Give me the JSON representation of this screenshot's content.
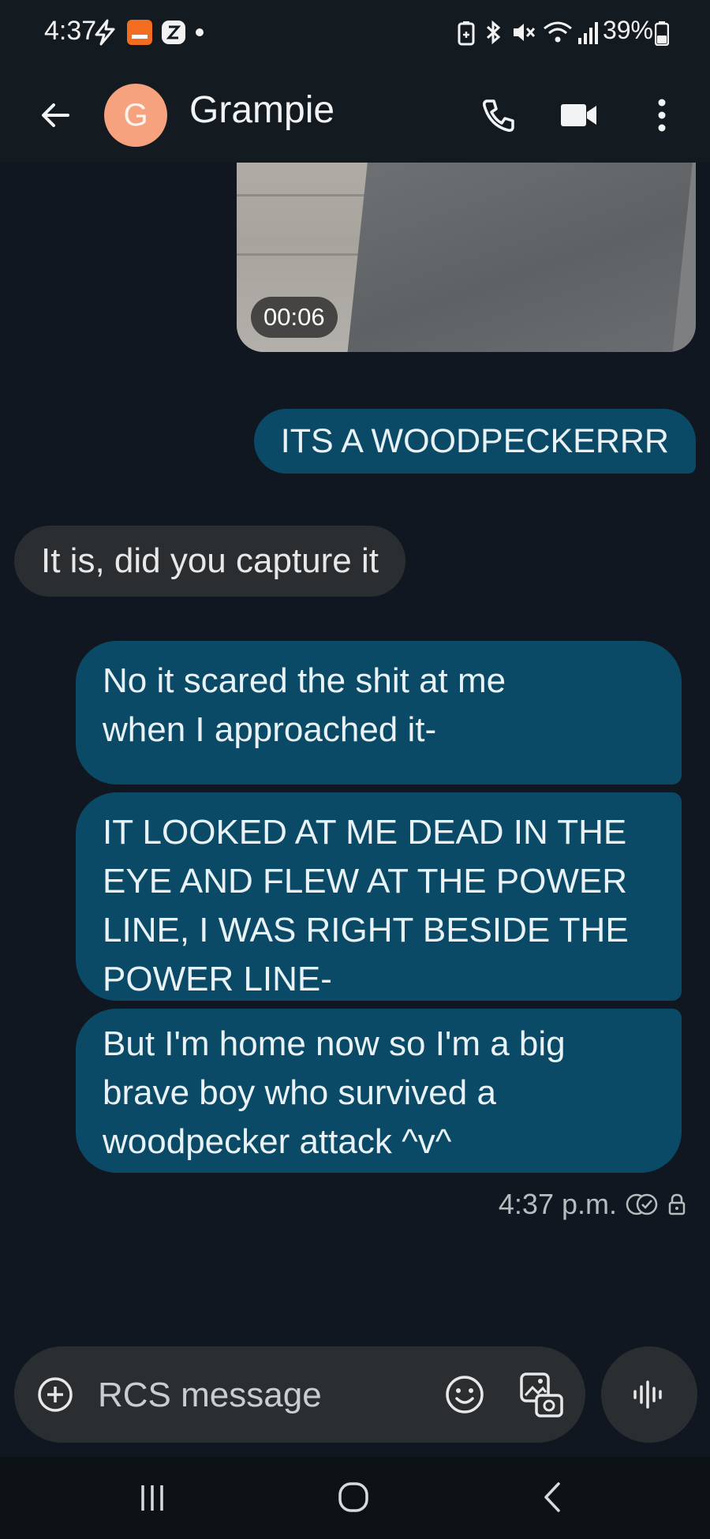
{
  "status_bar": {
    "time": "4:37",
    "battery": "39%",
    "icons": [
      "bolt-icon",
      "temu-icon",
      "z-app-icon",
      "dot-icon",
      "battery-saver-icon",
      "bluetooth-icon",
      "mute-icon",
      "wifi-icon",
      "signal-icon",
      "battery-icon"
    ]
  },
  "app_bar": {
    "back_icon": "arrow-back-icon",
    "avatar_letter": "G",
    "avatar_color": "#f6a27f",
    "contact_name": "Grampie",
    "actions": [
      "phone-icon",
      "video-call-icon",
      "more-vert-icon"
    ]
  },
  "conversation": {
    "video_duration": "00:06",
    "messages": [
      {
        "direction": "outgoing",
        "text": "ITS A WOODPECKERRR"
      },
      {
        "direction": "incoming",
        "text": "It is, did you capture it"
      },
      {
        "direction": "outgoing",
        "lines": [
          "No it scared the shit at me",
          "when I approached it-"
        ]
      },
      {
        "direction": "outgoing",
        "lines": [
          "IT LOOKED AT ME DEAD IN THE",
          "EYE AND FLEW AT THE POWER",
          "LINE, I WAS RIGHT BESIDE THE",
          "POWER LINE-"
        ]
      },
      {
        "direction": "outgoing",
        "lines": [
          "But I'm home now so I'm a big",
          "brave boy who survived a",
          "woodpecker attack ^v^"
        ]
      }
    ],
    "last_timestamp": "4:37 p.m.",
    "status_icons": [
      "read-receipt-icon",
      "lock-icon"
    ]
  },
  "compose": {
    "placeholder": "RCS message",
    "icons": [
      "add-circle-icon",
      "emoji-icon",
      "gallery-icon",
      "voice-icon"
    ]
  },
  "nav_bar": {
    "icons": [
      "recents-icon",
      "home-icon",
      "nav-back-icon"
    ]
  },
  "colors": {
    "background": "#101720",
    "outgoing_bubble": "#0b4a66",
    "incoming_bubble": "#2b2e31",
    "header": "#141b20"
  }
}
